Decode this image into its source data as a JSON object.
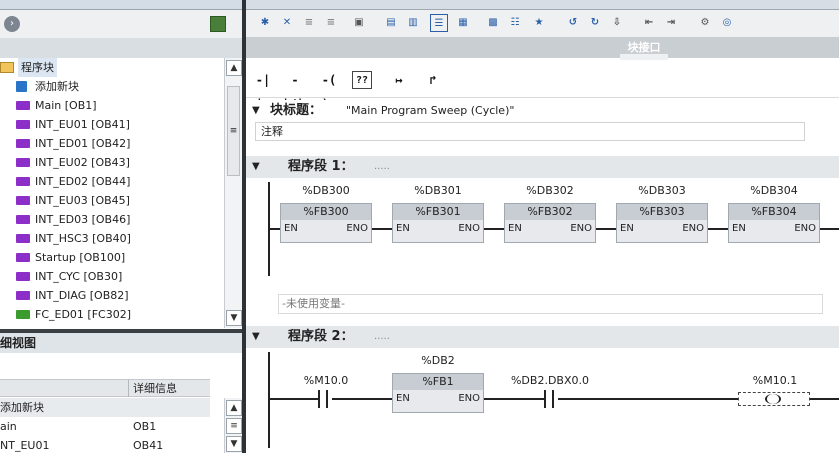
{
  "left_pane": {
    "tree": {
      "root_label": "程序块",
      "items": [
        {
          "label": "添加新块",
          "icon": "add-block-icon"
        },
        {
          "label": "Main [OB1]",
          "icon": "ob-block-icon"
        },
        {
          "label": "INT_EU01 [OB41]",
          "icon": "ob-block-icon"
        },
        {
          "label": "INT_ED01 [OB42]",
          "icon": "ob-block-icon"
        },
        {
          "label": "INT_EU02 [OB43]",
          "icon": "ob-block-icon"
        },
        {
          "label": "INT_ED02 [OB44]",
          "icon": "ob-block-icon"
        },
        {
          "label": "INT_EU03 [OB45]",
          "icon": "ob-block-icon"
        },
        {
          "label": "INT_ED03 [OB46]",
          "icon": "ob-block-icon"
        },
        {
          "label": "INT_HSC3 [OB40]",
          "icon": "ob-block-icon"
        },
        {
          "label": "Startup [OB100]",
          "icon": "ob-block-icon"
        },
        {
          "label": "INT_CYC [OB30]",
          "icon": "ob-block-icon"
        },
        {
          "label": "INT_DIAG [OB82]",
          "icon": "ob-block-icon"
        },
        {
          "label": "FC_ED01 [FC302]",
          "icon": "fc-block-icon"
        }
      ]
    },
    "detail_view": {
      "title": "细视图",
      "col2_header": "详细信息",
      "rows": [
        {
          "name": "添加新块",
          "info": ""
        },
        {
          "name": "ain",
          "info": "OB1"
        },
        {
          "name": "NT_EU01",
          "info": "OB41"
        }
      ]
    }
  },
  "right_pane": {
    "interface_label": "块接口",
    "ladder_toolbar": [
      "-| |-",
      "-|/|-",
      "-( )-",
      "??",
      "↦",
      "↱"
    ],
    "block_title": {
      "label": "块标题：",
      "value": "\"Main Program Sweep (Cycle)\""
    },
    "comment_label": "注释",
    "network1": {
      "title": "程序段 1：",
      "dots": ".....",
      "blocks": [
        {
          "db": "%DB300",
          "fb": "%FB300",
          "en": "EN",
          "eno": "ENO"
        },
        {
          "db": "%DB301",
          "fb": "%FB301",
          "en": "EN",
          "eno": "ENO"
        },
        {
          "db": "%DB302",
          "fb": "%FB302",
          "en": "EN",
          "eno": "ENO"
        },
        {
          "db": "%DB303",
          "fb": "%FB303",
          "en": "EN",
          "eno": "ENO"
        },
        {
          "db": "%DB304",
          "fb": "%FB304",
          "en": "EN",
          "eno": "ENO"
        }
      ],
      "unused_vars": "-未使用变量-"
    },
    "network2": {
      "title": "程序段 2：",
      "dots": ".....",
      "contact1": "%M10.0",
      "block": {
        "db": "%DB2",
        "fb": "%FB1",
        "en": "EN",
        "eno": "ENO"
      },
      "contact2": "%DB2.DBX0.0",
      "coil": "%M10.1"
    }
  }
}
